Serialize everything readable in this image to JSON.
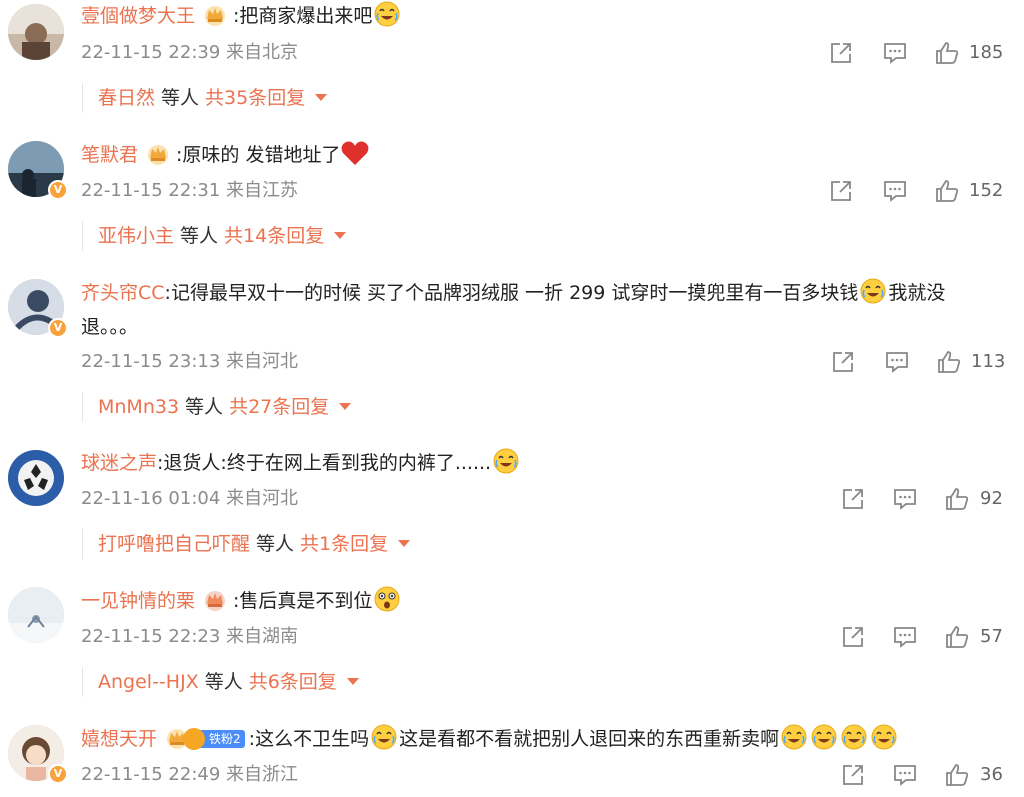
{
  "colors": {
    "accent": "#eb7350",
    "meta": "#8b8b8b",
    "badge": "#f7a23b"
  },
  "comments": [
    {
      "username": "壹個做梦大王",
      "separator": ":",
      "text": "把商家爆出来吧",
      "emoji_after": [
        "crying-laugh-emoji"
      ],
      "timestamp": "22-11-15 22:39",
      "location": "来自北京",
      "likes": "185",
      "reply_user": "春日然",
      "reply_mid": "等人",
      "reply_count": "共35条回复"
    },
    {
      "username": "笔默君",
      "separator": ":",
      "text": "原味的  发错地址了",
      "emoji_after": [
        "red-heart-emoji"
      ],
      "timestamp": "22-11-15 22:31",
      "location": "来自江苏",
      "likes": "152",
      "reply_user": "亚伟小主",
      "reply_mid": "等人",
      "reply_count": "共14条回复"
    },
    {
      "username": "齐头帘CC",
      "separator": ":",
      "text_a": "记得最早双十一的时候 买了个品牌羽绒服 一折 299 试穿时一摸兜里有一百多块钱",
      "text_b": "我就没退。。。",
      "timestamp": "22-11-15 23:13",
      "location": "来自河北",
      "likes": "113",
      "reply_user": "MnMn33",
      "reply_mid": "等人",
      "reply_count": "共27条回复"
    },
    {
      "username": "球迷之声",
      "separator": ":",
      "text": "退货人:终于在网上看到我的内裤了......",
      "timestamp": "22-11-16 01:04",
      "location": "来自河北",
      "likes": "92",
      "reply_user": "打呼噜把自己吓醒",
      "reply_mid": "等人",
      "reply_count": "共1条回复"
    },
    {
      "username": "一见钟情的栗",
      "separator": ":",
      "text": "售后真是不到位",
      "timestamp": "22-11-15 22:23",
      "location": "来自湖南",
      "likes": "57",
      "reply_user": "Angel--HJX",
      "reply_mid": "等人",
      "reply_count": "共6条回复"
    },
    {
      "username": "嬉想天开",
      "fan_badge": "铁粉2",
      "separator": ":",
      "text_a": "这么不卫生吗",
      "text_b": "这是看都不看就把别人退回来的东西重新卖啊",
      "timestamp": "22-11-15 22:49",
      "location": "来自浙江",
      "likes": "36"
    }
  ]
}
